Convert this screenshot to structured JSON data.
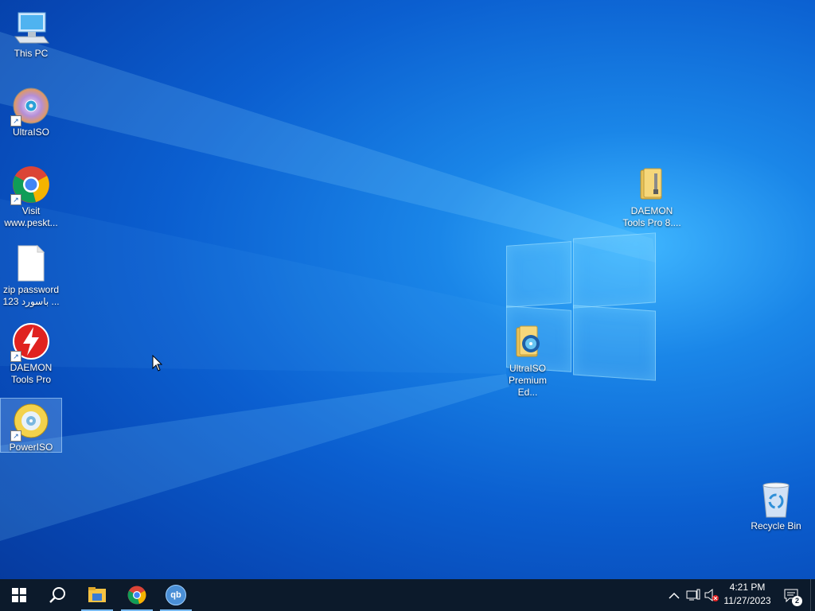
{
  "desktop": {
    "icons": [
      {
        "id": "this-pc",
        "label": "This PC"
      },
      {
        "id": "ultraiso",
        "label": "UltraISO"
      },
      {
        "id": "chrome",
        "label": "Visit www.peskt..."
      },
      {
        "id": "zip-password",
        "label": "zip password 123 باسورد ..."
      },
      {
        "id": "daemon-tools",
        "label": "DAEMON Tools Pro"
      },
      {
        "id": "poweriso",
        "label": "PowerISO"
      },
      {
        "id": "daemon-folder",
        "label": "DAEMON Tools Pro 8...."
      },
      {
        "id": "ultraiso-folder",
        "label": "UltraISO Premium Ed..."
      },
      {
        "id": "recycle-bin",
        "label": "Recycle Bin"
      }
    ]
  },
  "taskbar": {
    "apps": [
      {
        "name": "start",
        "icon": "windows-logo-icon"
      },
      {
        "name": "search",
        "icon": "search-icon"
      },
      {
        "name": "file-explorer",
        "icon": "folder-icon"
      },
      {
        "name": "chrome",
        "icon": "chrome-icon"
      },
      {
        "name": "qbittorrent",
        "icon": "qbittorrent-icon",
        "text": "qb"
      }
    ],
    "clock": {
      "time": "4:21 PM",
      "date": "11/27/2023"
    },
    "notifications": {
      "count": "2"
    }
  },
  "colors": {
    "taskbar": "#0c1a2b",
    "accent": "#77b9f0"
  }
}
